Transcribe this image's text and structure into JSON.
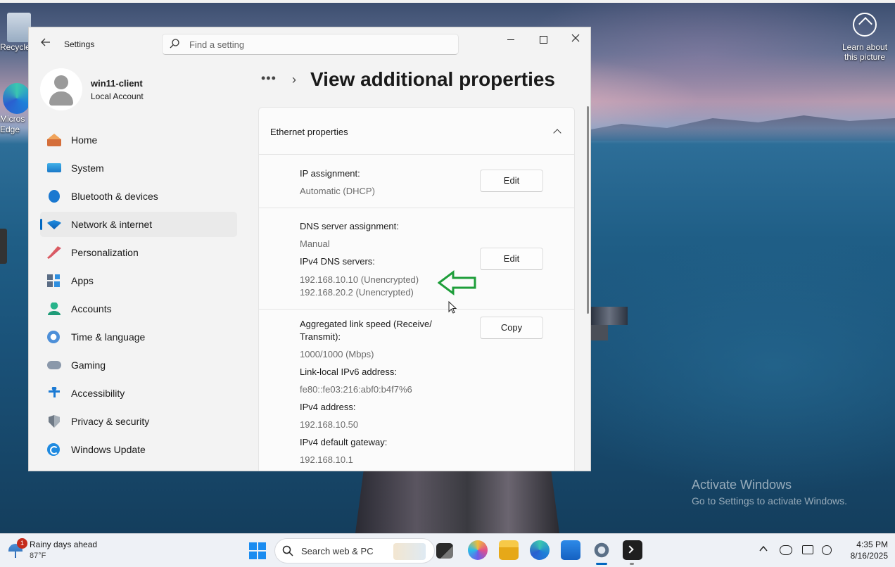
{
  "desktop": {
    "recycle_label": "Recycle",
    "edge_label_1": "Micros",
    "edge_label_2": "Edge",
    "learn_about_1": "Learn about",
    "learn_about_2": "this picture",
    "activate_title": "Activate Windows",
    "activate_sub": "Go to Settings to activate Windows."
  },
  "settings": {
    "app_title": "Settings",
    "search_placeholder": "Find a setting",
    "profile": {
      "name": "win11-client",
      "account_type": "Local Account"
    },
    "nav": [
      {
        "label": "Home",
        "icon": "home-icon"
      },
      {
        "label": "System",
        "icon": "system-icon"
      },
      {
        "label": "Bluetooth & devices",
        "icon": "bluetooth-icon"
      },
      {
        "label": "Network & internet",
        "icon": "network-icon",
        "active": true
      },
      {
        "label": "Personalization",
        "icon": "brush-icon"
      },
      {
        "label": "Apps",
        "icon": "apps-icon"
      },
      {
        "label": "Accounts",
        "icon": "accounts-icon"
      },
      {
        "label": "Time & language",
        "icon": "clock-icon"
      },
      {
        "label": "Gaming",
        "icon": "gamepad-icon"
      },
      {
        "label": "Accessibility",
        "icon": "accessibility-icon"
      },
      {
        "label": "Privacy & security",
        "icon": "shield-icon"
      },
      {
        "label": "Windows Update",
        "icon": "update-icon"
      }
    ],
    "breadcrumb": {
      "more": "•••",
      "separator": "›"
    },
    "page_title": "View additional properties",
    "card": {
      "title": "Ethernet properties",
      "ip_assignment_label": "IP assignment:",
      "ip_assignment_value": "Automatic (DHCP)",
      "dns_assignment_label": "DNS server assignment:",
      "dns_assignment_value": "Manual",
      "ipv4_dns_label": "IPv4 DNS servers:",
      "ipv4_dns_1": "192.168.10.10 (Unencrypted)",
      "ipv4_dns_2": "192.168.20.2 (Unencrypted)",
      "link_speed_label_1": "Aggregated link speed (Receive/",
      "link_speed_label_2": "Transmit):",
      "link_speed_value": "1000/1000 (Mbps)",
      "ipv6_ll_label": "Link-local IPv6 address:",
      "ipv6_ll_value": "fe80::fe03:216:abf0:b4f7%6",
      "ipv4_addr_label": "IPv4 address:",
      "ipv4_addr_value": "192.168.10.50",
      "ipv4_gw_label": "IPv4 default gateway:",
      "ipv4_gw_value": "192.168.10.1",
      "edit_label": "Edit",
      "copy_label": "Copy"
    }
  },
  "taskbar": {
    "weather_title": "Rainy days ahead",
    "weather_temp": "87°F",
    "weather_badge": "1",
    "search_text": "Search web & PC",
    "time": "4:35 PM",
    "date": "8/16/2025"
  },
  "colors": {
    "accent": "#0067c0",
    "annotation_arrow": "#1e9e3a"
  }
}
